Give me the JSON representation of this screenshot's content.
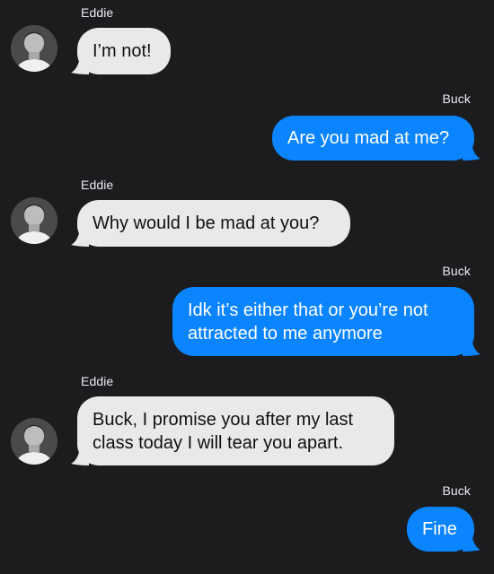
{
  "conversation": {
    "messages": [
      {
        "sender": "Eddie",
        "direction": "incoming",
        "text": "I’m not!"
      },
      {
        "sender": "Buck",
        "direction": "outgoing",
        "text": "Are you mad at me?"
      },
      {
        "sender": "Eddie",
        "direction": "incoming",
        "text": "Why would I be mad at you?"
      },
      {
        "sender": "Buck",
        "direction": "outgoing",
        "text": "Idk it’s either that or you’re not attracted to me anymore"
      },
      {
        "sender": "Eddie",
        "direction": "incoming",
        "text": "Buck, I promise you after my last class today I will tear you apart."
      },
      {
        "sender": "Buck",
        "direction": "outgoing",
        "text": "Fine"
      }
    ]
  },
  "colors": {
    "background": "#1c1c1e",
    "incoming_bubble": "#e9e9eb",
    "outgoing_bubble": "#0a84ff"
  },
  "icons": {
    "avatar": "contact-photo"
  }
}
